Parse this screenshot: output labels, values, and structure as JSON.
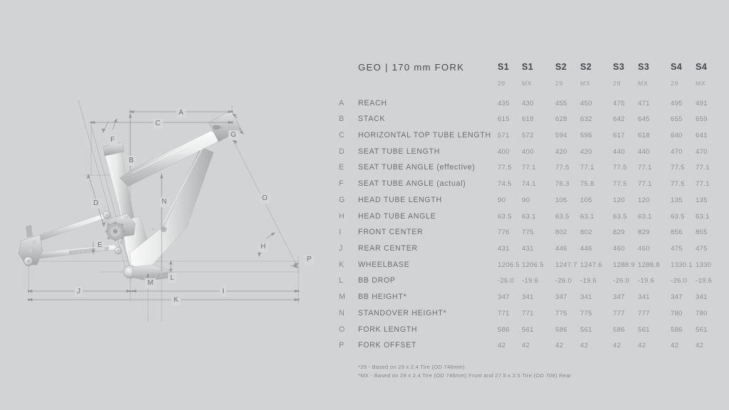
{
  "header": {
    "title": "GEO | 170 mm FORK",
    "columns": [
      {
        "size": "S1",
        "wheel": "29"
      },
      {
        "size": "S1",
        "wheel": "MX"
      },
      {
        "size": "S2",
        "wheel": "29"
      },
      {
        "size": "S2",
        "wheel": "MX"
      },
      {
        "size": "S3",
        "wheel": "29"
      },
      {
        "size": "S3",
        "wheel": "MX"
      },
      {
        "size": "S4",
        "wheel": "29"
      },
      {
        "size": "S4",
        "wheel": "MX"
      }
    ]
  },
  "chart_data": {
    "type": "table",
    "title": "GEO | 170 mm FORK",
    "categories": [
      "S1 29",
      "S1 MX",
      "S2 29",
      "S2 MX",
      "S3 29",
      "S3 MX",
      "S4 29",
      "S4 MX"
    ],
    "rows": [
      {
        "letter": "A",
        "label": "REACH",
        "values": [
          "435",
          "430",
          "455",
          "450",
          "475",
          "471",
          "495",
          "491"
        ]
      },
      {
        "letter": "B",
        "label": "STACK",
        "values": [
          "615",
          "618",
          "628",
          "632",
          "642",
          "645",
          "655",
          "659"
        ]
      },
      {
        "letter": "C",
        "label": "HORIZONTAL TOP TUBE LENGTH",
        "values": [
          "571",
          "572",
          "594",
          "595",
          "617",
          "618",
          "640",
          "641"
        ]
      },
      {
        "letter": "D",
        "label": "SEAT TUBE LENGTH",
        "values": [
          "400",
          "400",
          "420",
          "420",
          "440",
          "440",
          "470",
          "470"
        ]
      },
      {
        "letter": "E",
        "label": "SEAT TUBE ANGLE (effective)",
        "values": [
          "77.5",
          "77.1",
          "77.5",
          "77.1",
          "77.5",
          "77.1",
          "77.5",
          "77.1"
        ]
      },
      {
        "letter": "F",
        "label": "SEAT TUBE ANGLE (actual)",
        "values": [
          "74.5",
          "74.1",
          "76.3",
          "75.8",
          "77.5",
          "77.1",
          "77.5",
          "77.1"
        ]
      },
      {
        "letter": "G",
        "label": "HEAD TUBE LENGTH",
        "values": [
          "90",
          "90",
          "105",
          "105",
          "120",
          "120",
          "135",
          "135"
        ]
      },
      {
        "letter": "H",
        "label": "HEAD TUBE ANGLE",
        "values": [
          "63.5",
          "63.1",
          "63.5",
          "63.1",
          "63.5",
          "63.1",
          "63.5",
          "63.1"
        ]
      },
      {
        "letter": "I",
        "label": "FRONT CENTER",
        "values": [
          "776",
          "775",
          "802",
          "802",
          "829",
          "829",
          "856",
          "855"
        ]
      },
      {
        "letter": "J",
        "label": "REAR CENTER",
        "values": [
          "431",
          "431",
          "446",
          "446",
          "460",
          "460",
          "475",
          "475"
        ]
      },
      {
        "letter": "K",
        "label": "WHEELBASE",
        "values": [
          "1206.5",
          "1206.5",
          "1247.7",
          "1247.6",
          "1288.9",
          "1288.8",
          "1330.1",
          "1330"
        ]
      },
      {
        "letter": "L",
        "label": "BB DROP",
        "values": [
          "-26.0",
          "-19.6",
          "-26.0",
          "-19.6",
          "-26.0",
          "-19.6",
          "-26.0",
          "-19.6"
        ]
      },
      {
        "letter": "M",
        "label": "BB HEIGHT*",
        "values": [
          "347",
          "341",
          "347",
          "341",
          "347",
          "341",
          "347",
          "341"
        ]
      },
      {
        "letter": "N",
        "label": "STANDOVER HEIGHT*",
        "values": [
          "771",
          "771",
          "775",
          "775",
          "777",
          "777",
          "780",
          "780"
        ]
      },
      {
        "letter": "O",
        "label": "FORK LENGTH",
        "values": [
          "586",
          "561",
          "586",
          "561",
          "586",
          "561",
          "586",
          "561"
        ]
      },
      {
        "letter": "P",
        "label": "FORK OFFSET",
        "values": [
          "42",
          "42",
          "42",
          "42",
          "42",
          "42",
          "42",
          "42"
        ]
      }
    ]
  },
  "footnotes": [
    "*29 - Based on 29 x 2.4 Tire (OD 746mm)",
    "*MX - Based on 29 x 2.4 Tire (OD 746mm) Front and 27.5 x 2.5 Tire (OD 708) Rear"
  ],
  "diagram": {
    "callouts": [
      {
        "letter": "A"
      },
      {
        "letter": "B"
      },
      {
        "letter": "C"
      },
      {
        "letter": "D"
      },
      {
        "letter": "E"
      },
      {
        "letter": "F"
      },
      {
        "letter": "G"
      },
      {
        "letter": "H"
      },
      {
        "letter": "I"
      },
      {
        "letter": "J"
      },
      {
        "letter": "K"
      },
      {
        "letter": "L"
      },
      {
        "letter": "M"
      },
      {
        "letter": "N"
      },
      {
        "letter": "O"
      },
      {
        "letter": "P"
      }
    ]
  },
  "colors": {
    "background": "#d2d3d4",
    "title_text": "#4a4d50",
    "label_text": "#6b6e71",
    "value_text": "#8e9194",
    "muted_text": "#9a9da0",
    "frame_light": "#f2f2f2",
    "frame_mid": "#c9cacb",
    "frame_dark": "#a9abad",
    "dim_line": "#9b9d9f"
  }
}
